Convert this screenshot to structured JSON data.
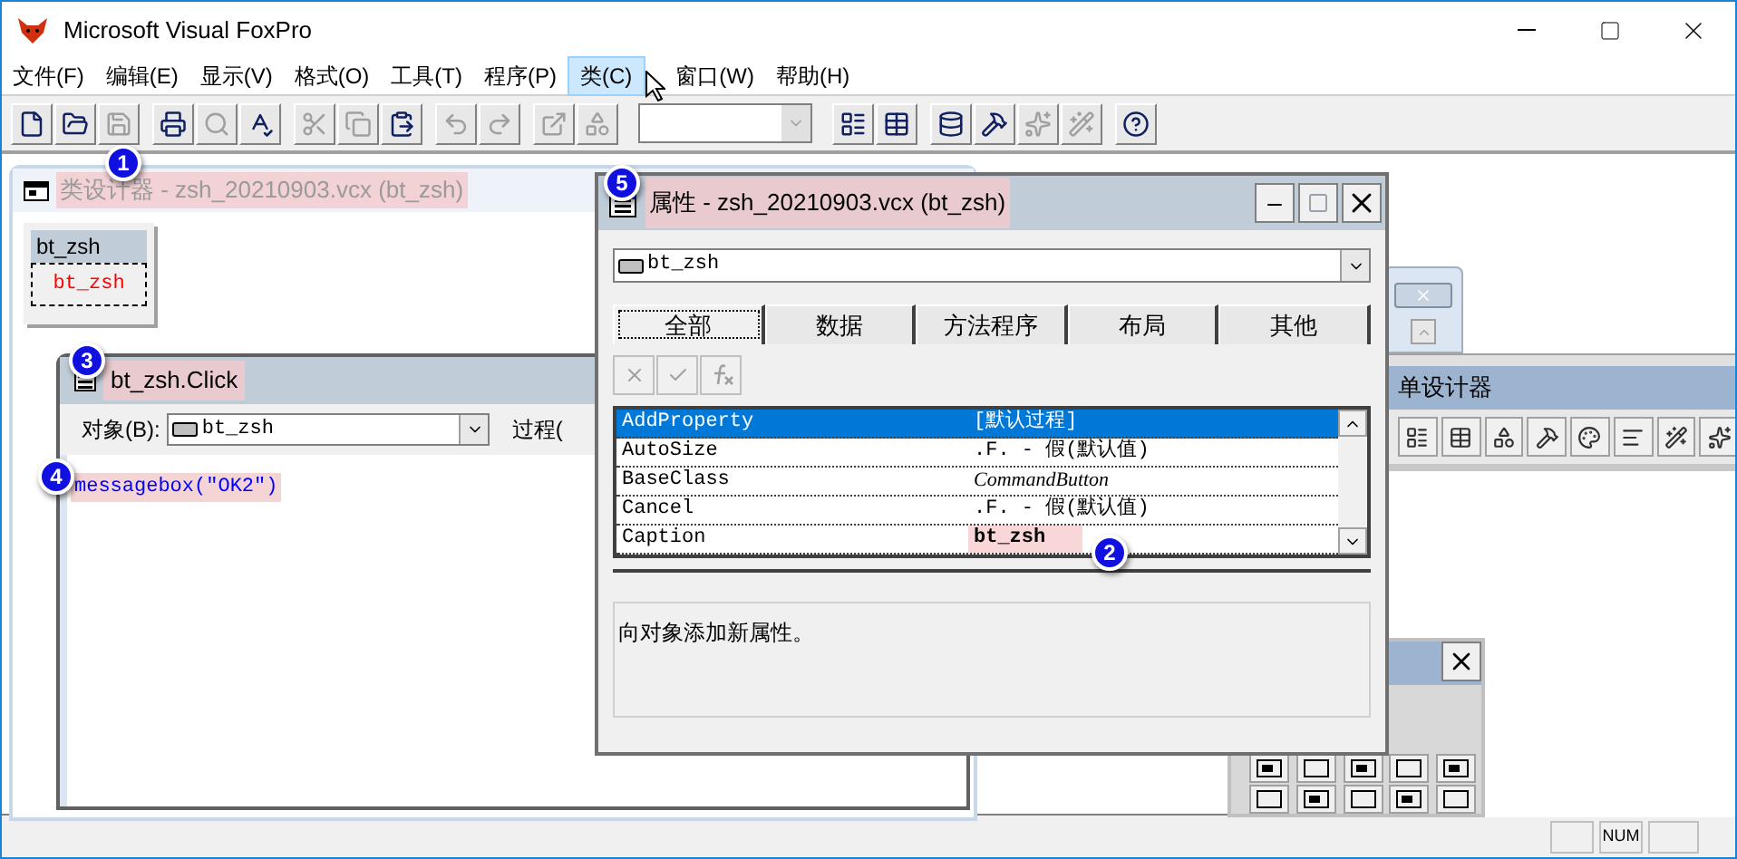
{
  "app": {
    "title": "Microsoft Visual FoxPro"
  },
  "menu": [
    {
      "label": "文件(F)",
      "selected": false
    },
    {
      "label": "编辑(E)",
      "selected": false
    },
    {
      "label": "显示(V)",
      "selected": false
    },
    {
      "label": "格式(O)",
      "selected": false
    },
    {
      "label": "工具(T)",
      "selected": false
    },
    {
      "label": "程序(P)",
      "selected": false
    },
    {
      "label": "类(C)",
      "selected": true
    },
    {
      "label": "窗口(W)",
      "selected": false
    },
    {
      "label": "帮助(H)",
      "selected": false
    }
  ],
  "toolbar": [
    {
      "kind": "new",
      "disabled": false
    },
    {
      "kind": "open",
      "disabled": false
    },
    {
      "kind": "save",
      "disabled": true
    },
    {
      "kind": "print",
      "disabled": false
    },
    {
      "kind": "preview",
      "disabled": true
    },
    {
      "kind": "spell",
      "disabled": false
    },
    {
      "kind": "cut",
      "disabled": true
    },
    {
      "kind": "copy",
      "disabled": true
    },
    {
      "kind": "paste",
      "disabled": false
    },
    {
      "kind": "undo",
      "disabled": true
    },
    {
      "kind": "redo",
      "disabled": true
    },
    {
      "kind": "run",
      "disabled": true
    },
    {
      "kind": "modify",
      "disabled": true
    },
    {
      "kind": "combo",
      "disabled": true
    },
    {
      "kind": "command",
      "disabled": false
    },
    {
      "kind": "datasession",
      "disabled": false
    },
    {
      "kind": "database",
      "disabled": false
    },
    {
      "kind": "builder",
      "disabled": false
    },
    {
      "kind": "autoform",
      "disabled": true
    },
    {
      "kind": "wizard",
      "disabled": true
    },
    {
      "kind": "help",
      "disabled": false
    }
  ],
  "class_designer": {
    "title": "类设计器 - zsh_20210903.vcx (bt_zsh)",
    "highlighted": true,
    "class_name": "bt_zsh",
    "button_caption": "bt_zsh"
  },
  "code_window": {
    "title": "bt_zsh.Click",
    "highlighted": true,
    "object_label": "对象(B):",
    "object_value": "bt_zsh",
    "procedure_label": "过程(",
    "code": "messagebox(\"OK2\")",
    "code_highlighted": true
  },
  "properties": {
    "title": "属性 - zsh_20210903.vcx (bt_zsh)",
    "highlighted": true,
    "object": "bt_zsh",
    "tabs": [
      {
        "label": "全部",
        "selected": true
      },
      {
        "label": "数据",
        "selected": false
      },
      {
        "label": "方法程序",
        "selected": false
      },
      {
        "label": "布局",
        "selected": false
      },
      {
        "label": "其他",
        "selected": false
      }
    ],
    "rows": [
      {
        "name": "AddProperty",
        "value": "[默认过程]",
        "kind": "default",
        "selected": true,
        "highlighted": false
      },
      {
        "name": "AutoSize",
        "value": ".F. - 假(默认值)",
        "kind": "default",
        "selected": false,
        "highlighted": false
      },
      {
        "name": "BaseClass",
        "value": "CommandButton",
        "kind": "readonly",
        "selected": false,
        "highlighted": false
      },
      {
        "name": "Cancel",
        "value": ".F. - 假(默认值)",
        "kind": "default",
        "selected": false,
        "highlighted": false
      },
      {
        "name": "Caption",
        "value": "bt_zsh",
        "kind": "modified",
        "selected": false,
        "highlighted": true
      }
    ],
    "description": "向对象添加新属性。"
  },
  "form_designer": {
    "title": "单设计器"
  },
  "callouts": [
    {
      "number": "1"
    },
    {
      "number": "2"
    },
    {
      "number": "3"
    },
    {
      "number": "4"
    },
    {
      "number": "5"
    }
  ],
  "status_bar": {
    "num": "NUM"
  }
}
